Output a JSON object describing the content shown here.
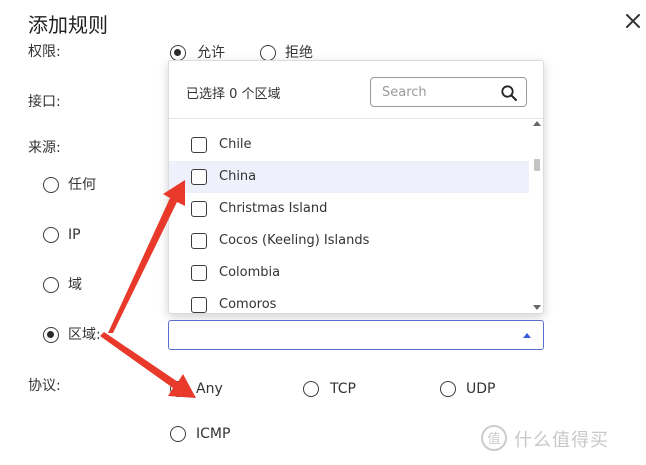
{
  "dialog": {
    "title": "添加规则",
    "close_icon": "close-icon"
  },
  "permission": {
    "label": "权限:",
    "options": [
      {
        "label": "允许",
        "checked": true
      },
      {
        "label": "拒绝",
        "checked": false
      }
    ]
  },
  "interface": {
    "label": "接口:"
  },
  "source": {
    "label": "来源:",
    "options": [
      {
        "label": "任何",
        "checked": false
      },
      {
        "label": "IP",
        "checked": false
      },
      {
        "label": "域",
        "checked": false
      },
      {
        "label": "区域:",
        "checked": true
      }
    ]
  },
  "region_dropdown": {
    "selected_count": "已选择 0 个区域",
    "search": {
      "placeholder": "Search",
      "value": ""
    },
    "items": [
      {
        "label": "Chile",
        "checked": false
      },
      {
        "label": "China",
        "checked": false,
        "highlighted": true
      },
      {
        "label": "Christmas Island",
        "checked": false
      },
      {
        "label": "Cocos (Keeling) Islands",
        "checked": false
      },
      {
        "label": "Colombia",
        "checked": false
      },
      {
        "label": "Comoros",
        "checked": false
      }
    ],
    "select_value": ""
  },
  "protocol": {
    "label": "协议:",
    "options": [
      {
        "label": "Any",
        "checked": true
      },
      {
        "label": "TCP",
        "checked": false
      },
      {
        "label": "UDP",
        "checked": false
      },
      {
        "label": "ICMP",
        "checked": false
      }
    ]
  },
  "annotation": {
    "arrow_color": "#e8392a"
  },
  "watermark": {
    "text": "什么值得买"
  },
  "colors": {
    "highlight_row": "#eef0fb",
    "select_border": "#5b6fcf",
    "select_caret": "#3b5bdb"
  }
}
